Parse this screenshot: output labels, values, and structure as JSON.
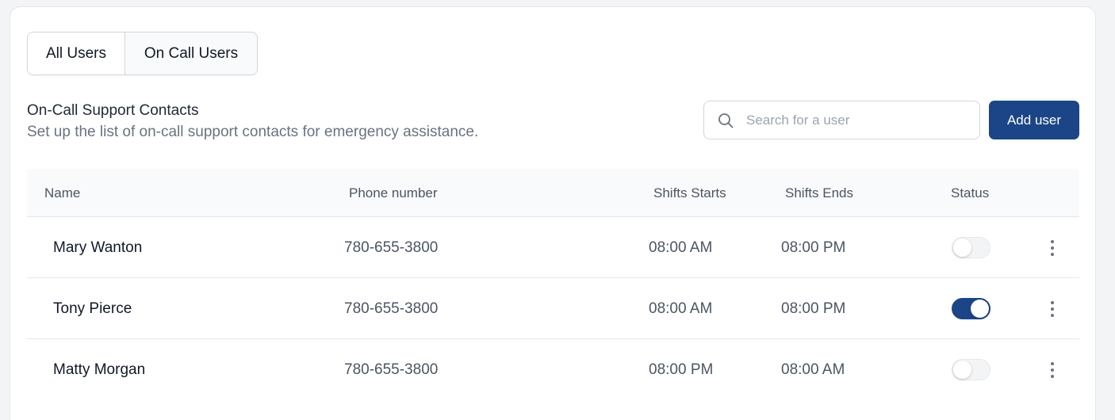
{
  "tabs": [
    {
      "label": "All Users",
      "active": false
    },
    {
      "label": "On Call Users",
      "active": true
    }
  ],
  "section": {
    "title": "On-Call Support Contacts",
    "subtitle": "Set up the list of on-call support contacts for emergency assistance."
  },
  "search": {
    "placeholder": "Search for a user",
    "value": "",
    "icon": "search-icon"
  },
  "add_button": {
    "label": "Add user"
  },
  "colors": {
    "accent": "#1c4587"
  },
  "table": {
    "headers": {
      "name": "Name",
      "phone": "Phone number",
      "start": "Shifts Starts",
      "end": "Shifts Ends",
      "status": "Status"
    },
    "rows": [
      {
        "name": "Mary Wanton",
        "phone": "780-655-3800",
        "start": "08:00 AM",
        "end": "08:00 PM",
        "status": false
      },
      {
        "name": "Tony Pierce",
        "phone": "780-655-3800",
        "start": "08:00 AM",
        "end": "08:00 PM",
        "status": true
      },
      {
        "name": "Matty Morgan",
        "phone": "780-655-3800",
        "start": "08:00 PM",
        "end": "08:00 AM",
        "status": false
      }
    ]
  }
}
